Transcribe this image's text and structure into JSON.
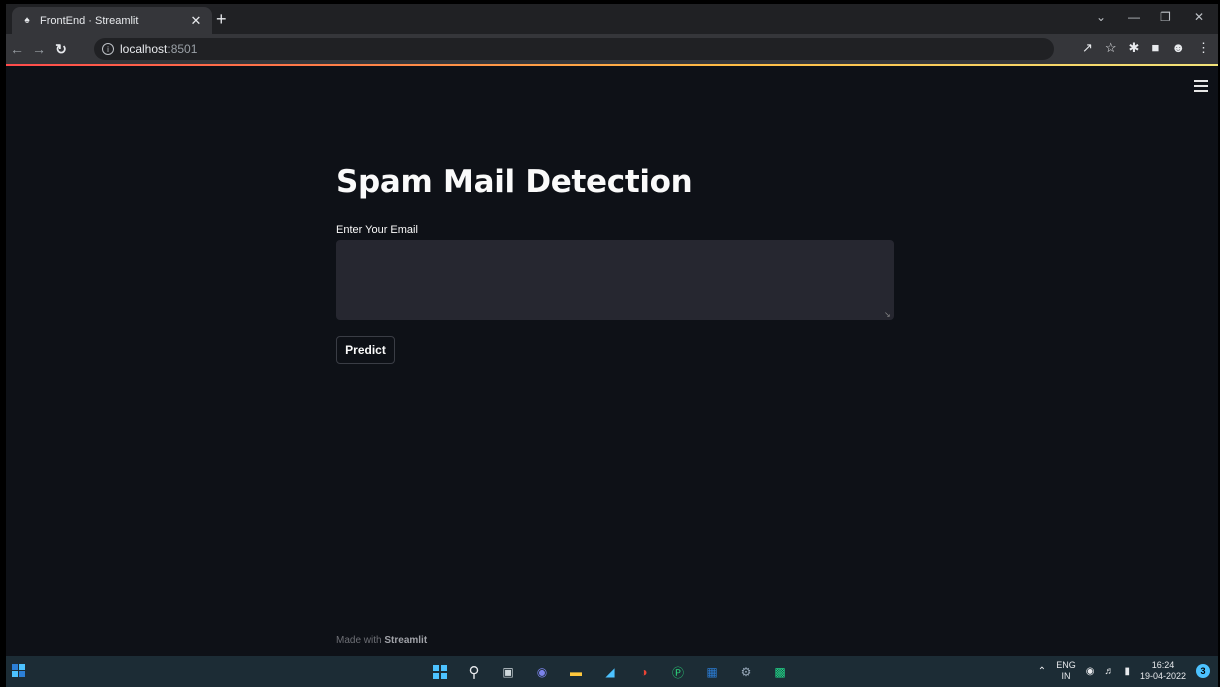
{
  "browser": {
    "tab_title": "FrontEnd · Streamlit",
    "url_host": "localhost",
    "url_port": ":8501"
  },
  "app": {
    "title": "Spam Mail Detection",
    "email_label": "Enter Your Email",
    "email_value": "",
    "predict_label": "Predict",
    "footer_prefix": "Made with ",
    "footer_brand": "Streamlit"
  },
  "taskbar": {
    "lang_top": "ENG",
    "lang_bottom": "IN",
    "time": "16:24",
    "date": "19-04-2022",
    "notification_count": "3"
  },
  "colors": {
    "background": "#0e1117",
    "input_bg": "#262730",
    "accent_start": "#ff4b4b",
    "accent_end": "#f2e37a",
    "taskbar": "#1c2c35"
  }
}
